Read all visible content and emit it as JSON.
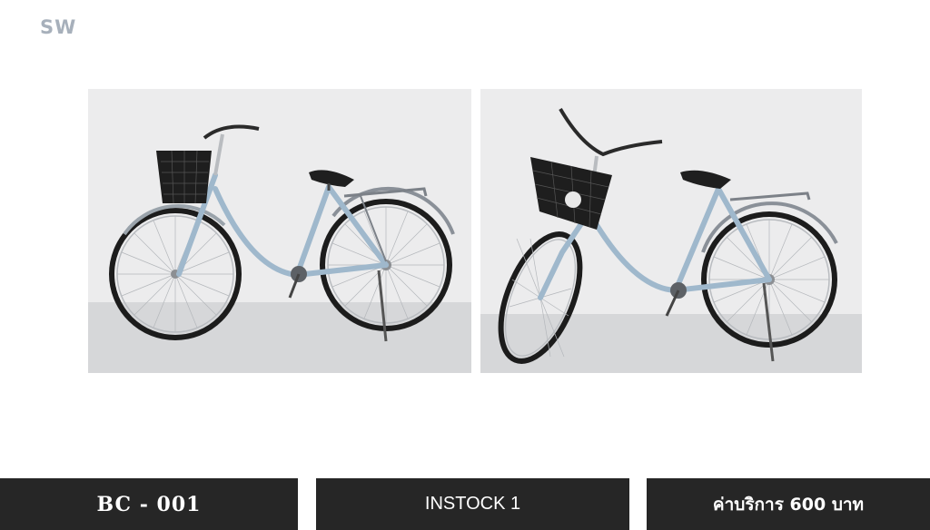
{
  "brand": {
    "text": "SW"
  },
  "product": {
    "code": "BC - 001",
    "stock": "INSTOCK 1",
    "price": "ค่าบริการ 600 บาท"
  },
  "colors": {
    "frame": "#9fb8cc",
    "tire": "#1c1c1c",
    "wall": "#ececed",
    "floor": "#d6d7d9",
    "bar_bg": "#262626"
  }
}
